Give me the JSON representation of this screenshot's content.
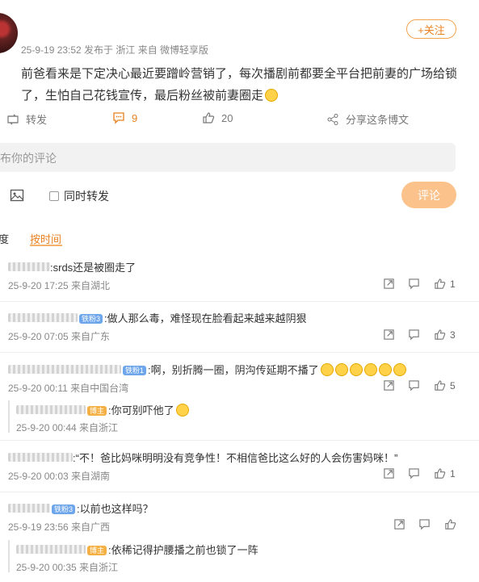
{
  "post": {
    "meta": "25-9-19 23:52  发布于 浙江  来自 微博轻享版",
    "follow_label": "+关注",
    "text": "前爸看来是下定决心最近要蹭岭营销了，每次播剧前都要全平台把前妻的广场给锁了，生怕自己花钱宣传，最后粉丝被前妻圈走",
    "emoji": "smile-emoji"
  },
  "actions": {
    "repost": "转发",
    "comments": "9",
    "likes": "20",
    "share": "分享这条博文"
  },
  "composer": {
    "placeholder": "布你的评论",
    "repost_label": "同时转发",
    "submit_label": "评论"
  },
  "sort": {
    "hot": "度",
    "time": "按时间"
  },
  "comments": [
    {
      "text": ":srds还是被圈走了",
      "meta": "25-9-20 17:25 来自湖北",
      "likes": "1",
      "badge": ""
    },
    {
      "text": ":做人那么毒，难怪现在脸看起来越来越阴狠",
      "meta": "25-9-20 07:05 来自广东",
      "likes": "3",
      "badge": "铁粉3"
    },
    {
      "text": ":啊，别折腾一圈，阴沟传延期不播了",
      "meta": "25-9-20 00:11 来自中国台湾",
      "likes": "5",
      "badge": "铁粉1"
    },
    {
      "text": ":你可别吓他了",
      "meta": "25-9-20 00:44 来自浙江",
      "likes": "",
      "badge": "博主"
    },
    {
      "text": ":“不！爸比妈咪明明没有竞争性！不相信爸比这么好的人会伤害妈咪！”",
      "meta": "25-9-20 00:03 来自湖南",
      "likes": "1",
      "badge": ""
    },
    {
      "text": ":以前也这样吗？",
      "meta": "25-9-19 23:56 来自广西",
      "likes": "",
      "badge": "铁粉3"
    },
    {
      "text": ":依稀记得护腰播之前也锁了一阵",
      "meta": "25-9-20 00:35 来自浙江",
      "likes": "",
      "badge": "博主"
    }
  ]
}
